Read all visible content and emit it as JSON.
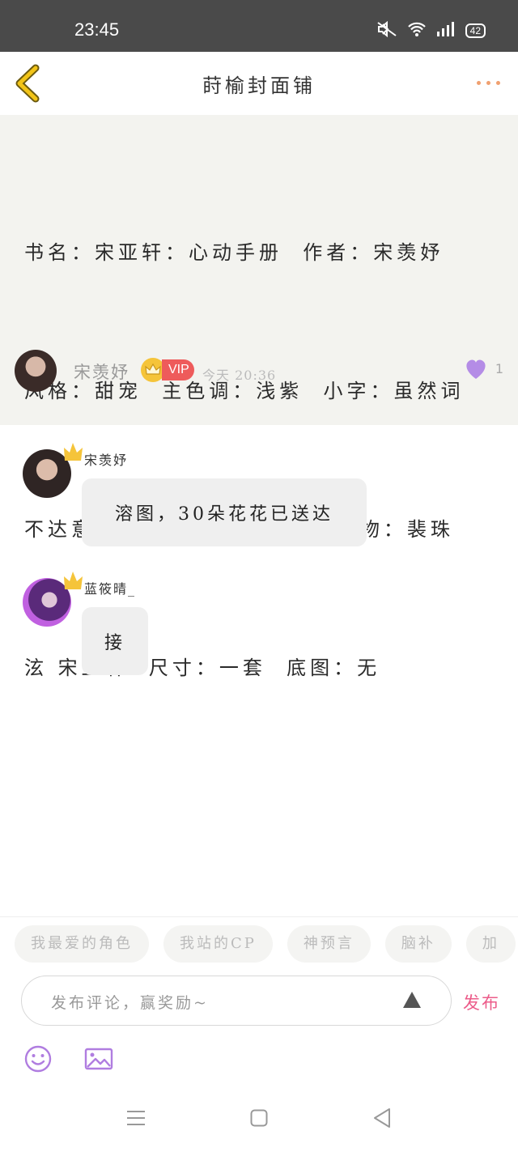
{
  "status_bar": {
    "time": "23:45",
    "battery": "42",
    "icons": [
      "mute-icon",
      "wifi-icon",
      "signal-icon",
      "battery-icon"
    ]
  },
  "nav": {
    "title": "莳榆封面铺",
    "back_icon": "chevron-left-icon",
    "more_icon": "more-dots-icon",
    "accent_color": "#f0c020"
  },
  "post": {
    "lines": [
      "书名：宋亚轩：心动手册  作者：宋羡妤",
      "风格：甜宠  主色调：浅紫  小字：虽然词",
      "不达意 但遇见你真的很开心. 人物：裴珠",
      "泫 宋亚轩  尺寸：一套  底图：无"
    ],
    "author": "宋羡妤",
    "vip_label": "VIP",
    "time": "今天 20:36",
    "likes": "1",
    "like_color": "#b48ce6"
  },
  "comments": [
    {
      "user": "宋羡妤",
      "text": "溶图，30朵花花已送达"
    },
    {
      "user": "蓝筱晴_",
      "text": "接"
    }
  ],
  "tags": [
    "我最爱的角色",
    "我站的CP",
    "神预言",
    "脑补",
    "加"
  ],
  "input": {
    "placeholder": "发布评论，赢奖励~",
    "publish_label": "发布"
  },
  "toolbar_icons": [
    "emoji-icon",
    "image-icon"
  ],
  "system_nav": [
    "menu-icon",
    "home-icon",
    "back-icon"
  ]
}
